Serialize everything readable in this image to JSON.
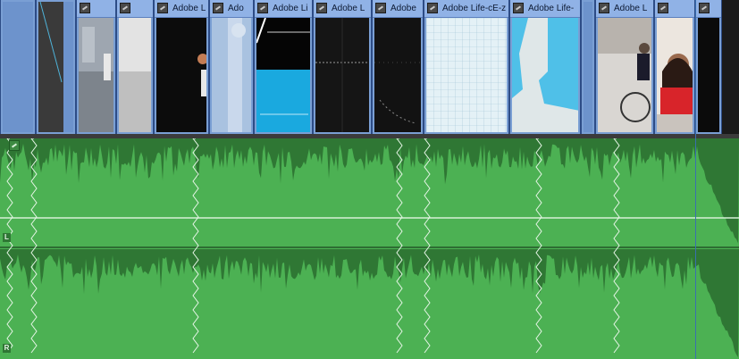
{
  "timeline": {
    "video_track": {
      "clips": [
        {
          "label": ""
        },
        {
          "label": ""
        },
        {
          "label": ""
        },
        {
          "label": "Adobe L"
        },
        {
          "label": "Ado"
        },
        {
          "label": "Adobe Li"
        },
        {
          "label": "Adobe L"
        },
        {
          "label": "Adobe"
        },
        {
          "label": "Adobe Life-cE-z"
        },
        {
          "label": "Adobe Life-"
        },
        {
          "label": "Adobe L"
        },
        {
          "label": ""
        },
        {
          "label": ""
        }
      ]
    },
    "audio_track": {
      "channel_left_label": "L",
      "channel_right_label": "R"
    }
  },
  "colors": {
    "video_clip": "#7a9fd4",
    "audio_clip": "#4cb153",
    "waveform": "#2f7734",
    "playhead": "#3a6fb0"
  },
  "icons": {
    "clip_fx": "fx-badge-icon",
    "cut_marker": "zigzag-cut-icon"
  }
}
